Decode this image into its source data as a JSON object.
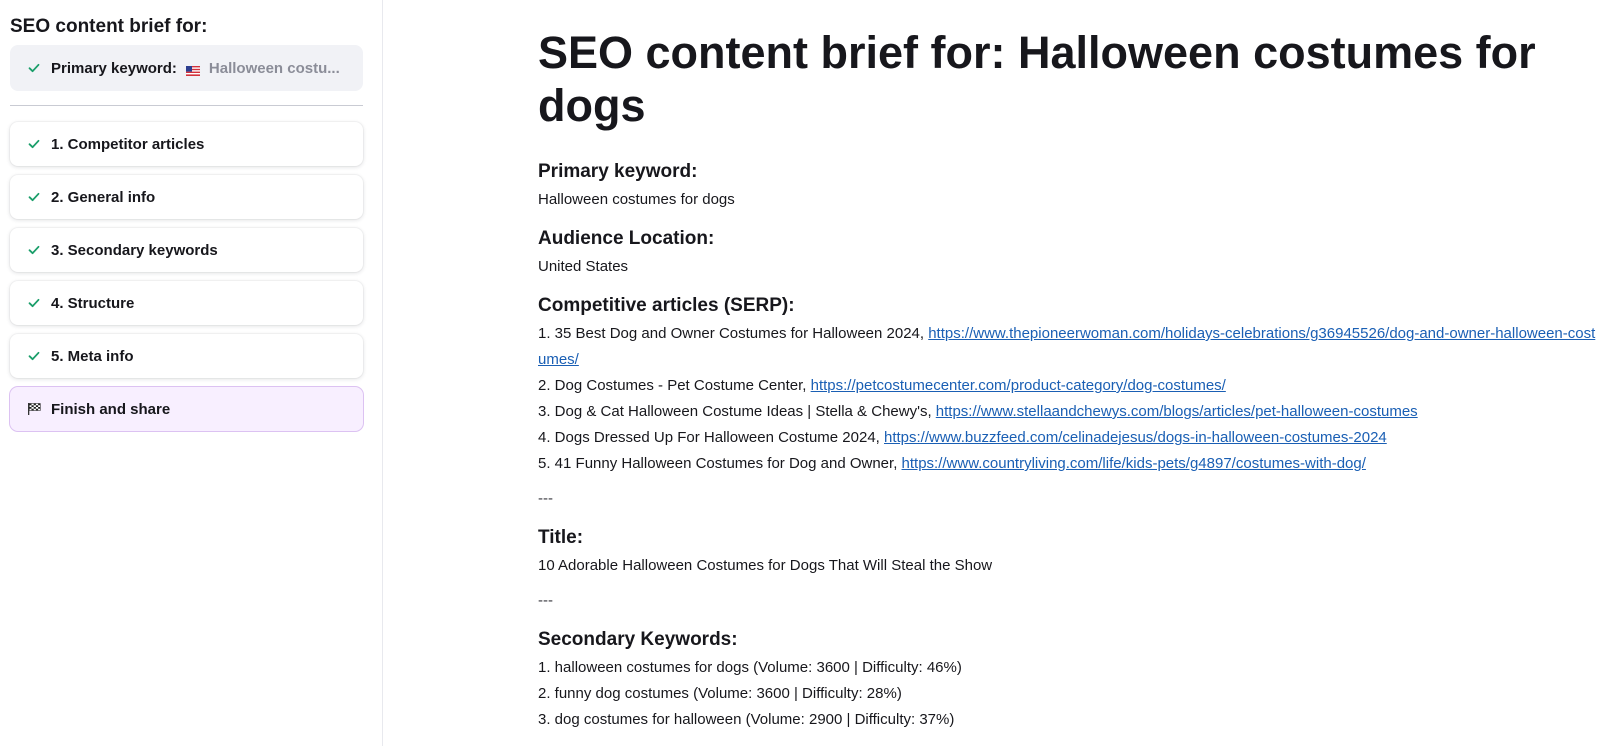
{
  "sidebar": {
    "title": "SEO content brief for:",
    "primary": {
      "label": "Primary keyword:",
      "value": "Halloween costu...",
      "flag_icon": "us-flag-icon"
    },
    "steps": [
      {
        "label": "1. Competitor articles",
        "icon": "check-icon"
      },
      {
        "label": "2. General info",
        "icon": "check-icon"
      },
      {
        "label": "3. Secondary keywords",
        "icon": "check-icon"
      },
      {
        "label": "4. Structure",
        "icon": "check-icon"
      },
      {
        "label": "5. Meta info",
        "icon": "check-icon"
      },
      {
        "label": "Finish and share",
        "icon": "checkered-flag-icon"
      }
    ]
  },
  "main": {
    "title": "SEO content brief for: Halloween costumes for dogs",
    "primary_keyword": {
      "heading": "Primary keyword:",
      "value": "Halloween costumes for dogs"
    },
    "audience": {
      "heading": "Audience Location:",
      "value": "United States"
    },
    "competitive": {
      "heading": "Competitive articles (SERP):",
      "items": [
        {
          "text": "1. 35 Best Dog and Owner Costumes for Halloween 2024, ",
          "url": "https://www.thepioneerwoman.com/holidays-celebrations/g36945526/dog-and-owner-halloween-costumes/"
        },
        {
          "text": "2. Dog Costumes - Pet Costume Center, ",
          "url": "https://petcostumecenter.com/product-category/dog-costumes/"
        },
        {
          "text": "3. Dog & Cat Halloween Costume Ideas | Stella & Chewy's, ",
          "url": "https://www.stellaandchewys.com/blogs/articles/pet-halloween-costumes"
        },
        {
          "text": "4. Dogs Dressed Up For Halloween Costume 2024, ",
          "url": "https://www.buzzfeed.com/celinadejesus/dogs-in-halloween-costumes-2024"
        },
        {
          "text": "5. 41 Funny Halloween Costumes for Dog and Owner, ",
          "url": "https://www.countryliving.com/life/kids-pets/g4897/costumes-with-dog/"
        }
      ]
    },
    "separator": "---",
    "title_section": {
      "heading": "Title:",
      "value": "10 Adorable Halloween Costumes for Dogs That Will Steal the Show"
    },
    "secondary": {
      "heading": "Secondary Keywords:",
      "items": [
        "1. halloween costumes for dogs (Volume: 3600 | Difficulty: 46%)",
        "2. funny dog costumes (Volume: 3600 | Difficulty: 28%)",
        "3. dog costumes for halloween (Volume: 2900 | Difficulty: 37%)"
      ]
    }
  },
  "colors": {
    "check": "#1a9e6a",
    "link": "#1a5fb4",
    "finish_bg": "#f8efff",
    "keyword_box_bg": "#f1f2f6"
  }
}
